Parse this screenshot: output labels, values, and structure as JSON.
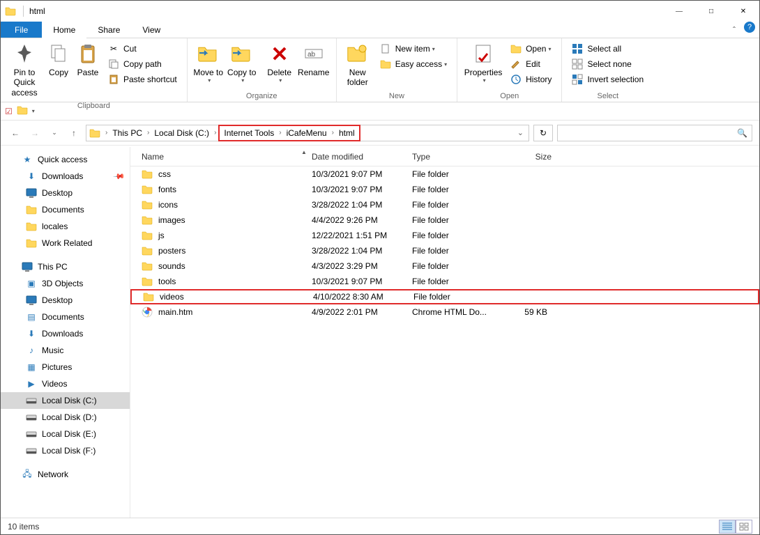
{
  "window_title": "html",
  "tabs": {
    "file": "File",
    "home": "Home",
    "share": "Share",
    "view": "View"
  },
  "ribbon": {
    "clipboard": {
      "label": "Clipboard",
      "pin": "Pin to Quick access",
      "copy": "Copy",
      "paste": "Paste",
      "cut": "Cut",
      "copy_path": "Copy path",
      "paste_shortcut": "Paste shortcut"
    },
    "organize": {
      "label": "Organize",
      "move_to": "Move to",
      "copy_to": "Copy to",
      "delete": "Delete",
      "rename": "Rename"
    },
    "new": {
      "label": "New",
      "new_folder": "New folder",
      "new_item": "New item",
      "easy_access": "Easy access"
    },
    "open": {
      "label": "Open",
      "properties": "Properties",
      "open": "Open",
      "edit": "Edit",
      "history": "History"
    },
    "select": {
      "label": "Select",
      "select_all": "Select all",
      "select_none": "Select none",
      "invert": "Invert selection"
    }
  },
  "breadcrumbs": {
    "this_pc": "This PC",
    "disk_c": "Local Disk (C:)",
    "internet_tools": "Internet Tools",
    "icafemenu": "iCafeMenu",
    "html": "html"
  },
  "columns": {
    "name": "Name",
    "date": "Date modified",
    "type": "Type",
    "size": "Size"
  },
  "nav": {
    "quick_access": "Quick access",
    "downloads": "Downloads",
    "desktop": "Desktop",
    "documents": "Documents",
    "locales": "locales",
    "work_related": "Work Related",
    "this_pc": "This PC",
    "three_d": "3D Objects",
    "desktop2": "Desktop",
    "documents2": "Documents",
    "downloads2": "Downloads",
    "music": "Music",
    "pictures": "Pictures",
    "videos": "Videos",
    "local_c": "Local Disk (C:)",
    "local_d": "Local Disk (D:)",
    "local_e": "Local Disk (E:)",
    "local_f": "Local Disk (F:)",
    "network": "Network"
  },
  "rows": [
    {
      "name": "css",
      "date": "10/3/2021 9:07 PM",
      "type": "File folder",
      "size": "",
      "icon": "folder"
    },
    {
      "name": "fonts",
      "date": "10/3/2021 9:07 PM",
      "type": "File folder",
      "size": "",
      "icon": "folder"
    },
    {
      "name": "icons",
      "date": "3/28/2022 1:04 PM",
      "type": "File folder",
      "size": "",
      "icon": "folder"
    },
    {
      "name": "images",
      "date": "4/4/2022 9:26 PM",
      "type": "File folder",
      "size": "",
      "icon": "folder"
    },
    {
      "name": "js",
      "date": "12/22/2021 1:51 PM",
      "type": "File folder",
      "size": "",
      "icon": "folder"
    },
    {
      "name": "posters",
      "date": "3/28/2022 1:04 PM",
      "type": "File folder",
      "size": "",
      "icon": "folder"
    },
    {
      "name": "sounds",
      "date": "4/3/2022 3:29 PM",
      "type": "File folder",
      "size": "",
      "icon": "folder"
    },
    {
      "name": "tools",
      "date": "10/3/2021 9:07 PM",
      "type": "File folder",
      "size": "",
      "icon": "folder"
    },
    {
      "name": "videos",
      "date": "4/10/2022 8:30 AM",
      "type": "File folder",
      "size": "",
      "icon": "folder",
      "highlight": true
    },
    {
      "name": "main.htm",
      "date": "4/9/2022 2:01 PM",
      "type": "Chrome HTML Do...",
      "size": "59 KB",
      "icon": "chrome"
    }
  ],
  "status": "10 items"
}
